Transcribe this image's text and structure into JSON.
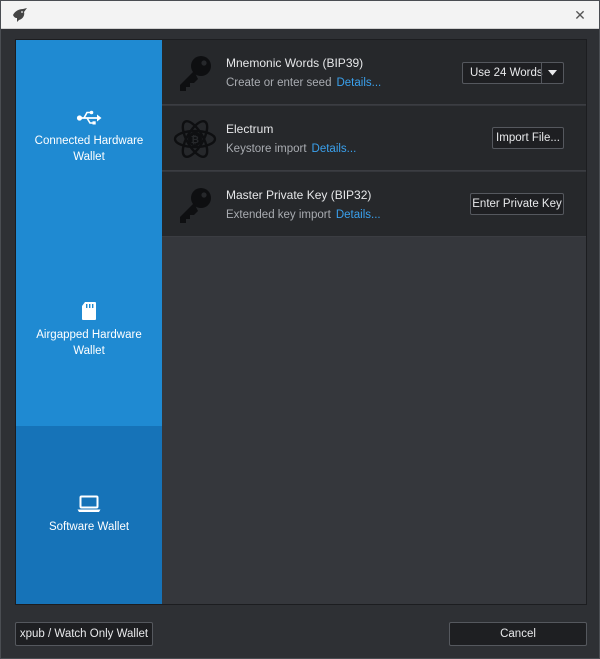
{
  "window": {
    "close_symbol": "✕"
  },
  "sidebar": {
    "items": [
      {
        "label": "Connected Hardware Wallet",
        "icon": "usb-icon",
        "selected": false
      },
      {
        "label": "Airgapped Hardware Wallet",
        "icon": "sd-card-icon",
        "selected": false
      },
      {
        "label": "Software Wallet",
        "icon": "laptop-icon",
        "selected": true
      }
    ]
  },
  "options": [
    {
      "title": "Mnemonic Words (BIP39)",
      "subtitle": "Create or enter seed",
      "details": "Details...",
      "button": "Use 24 Words",
      "icon": "key-icon"
    },
    {
      "title": "Electrum",
      "subtitle": "Keystore import",
      "details": "Details...",
      "button": "Import File...",
      "icon": "electrum-icon"
    },
    {
      "title": "Master Private Key (BIP32)",
      "subtitle": "Extended key import",
      "details": "Details...",
      "button": "Enter Private Key",
      "icon": "key-icon"
    }
  ],
  "footer": {
    "watch_only": "xpub / Watch Only Wallet",
    "cancel": "Cancel"
  },
  "colors": {
    "accent": "#1f8ad2",
    "accent_selected": "#1673b8",
    "link": "#3aa0ec"
  }
}
